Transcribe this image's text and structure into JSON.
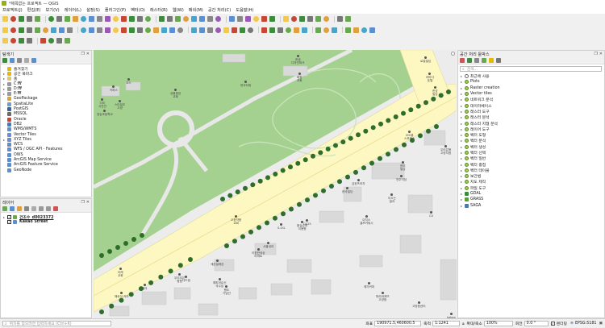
{
  "window": {
    "title": "*제목없는 프로젝트 — QGIS"
  },
  "menu": [
    "프로젝트(J)",
    "편집(E)",
    "보기(V)",
    "레이어(L)",
    "설정(S)",
    "플러그인(P)",
    "벡터(O)",
    "래스터(R)",
    "웹(W)",
    "메쉬(M)",
    "공간 처리(C)",
    "도움말(H)"
  ],
  "browser_panel": {
    "title": "탐색기",
    "items": [
      {
        "label": "즐겨찾기",
        "icon": "star-icon",
        "color": "#e6b800",
        "expand": ""
      },
      {
        "label": "공간 북마크",
        "icon": "bookmark-icon",
        "color": "#e6b800",
        "expand": "▸"
      },
      {
        "label": "홈",
        "icon": "home-folder-icon",
        "color": "#e9c36a",
        "expand": "▸"
      },
      {
        "label": "C:₩",
        "icon": "drive-icon",
        "color": "#999999",
        "expand": "▸"
      },
      {
        "label": "D:₩",
        "icon": "drive-icon",
        "color": "#999999",
        "expand": "▸"
      },
      {
        "label": "E:₩",
        "icon": "drive-icon",
        "color": "#999999",
        "expand": "▸"
      },
      {
        "label": "GeoPackage",
        "icon": "geopackage-icon",
        "color": "#d4a640",
        "expand": ""
      },
      {
        "label": "SpatiaLite",
        "icon": "spatialite-icon",
        "color": "#6f9dd6",
        "expand": ""
      },
      {
        "label": "PostGIS",
        "icon": "postgis-icon",
        "color": "#3466a5",
        "expand": ""
      },
      {
        "label": "MSSQL",
        "icon": "mssql-icon",
        "color": "#6a6a6a",
        "expand": ""
      },
      {
        "label": "Oracle",
        "icon": "oracle-icon",
        "color": "#c74634",
        "expand": ""
      },
      {
        "label": "DB2",
        "icon": "db2-icon",
        "color": "#4a7ab3",
        "expand": ""
      },
      {
        "label": "WMS/WMTS",
        "icon": "wms-icon",
        "color": "#5b8fd0",
        "expand": ""
      },
      {
        "label": "Vector Tiles",
        "icon": "vector-tiles-icon",
        "color": "#6f8cd0",
        "expand": ""
      },
      {
        "label": "XYZ Tiles",
        "icon": "xyz-tiles-icon",
        "color": "#6f8cd0",
        "expand": "▸"
      },
      {
        "label": "WCS",
        "icon": "wcs-icon",
        "color": "#5b8fd0",
        "expand": ""
      },
      {
        "label": "WFS / OGC API - Features",
        "icon": "wfs-icon",
        "color": "#5b8fd0",
        "expand": ""
      },
      {
        "label": "OWS",
        "icon": "ows-icon",
        "color": "#5b8fd0",
        "expand": ""
      },
      {
        "label": "ArcGIS Map Service",
        "icon": "arcgis-icon",
        "color": "#5b8fd0",
        "expand": ""
      },
      {
        "label": "ArcGIS Feature Service",
        "icon": "arcgis-icon",
        "color": "#5b8fd0",
        "expand": ""
      },
      {
        "label": "GeoNode",
        "icon": "geonode-icon",
        "color": "#5b8fd0",
        "expand": ""
      }
    ]
  },
  "layers_panel": {
    "title": "레이어",
    "layers": [
      {
        "label": "건조수_d0023372",
        "underline": true
      },
      {
        "label": "Kakao Street",
        "underline": false
      }
    ]
  },
  "toolbox_panel": {
    "title": "공간 처리 툴박스",
    "search_placeholder": "검색...",
    "items": [
      {
        "label": "최근에 사용",
        "icon": "clock-icon"
      },
      {
        "label": "Plots",
        "icon": "algorithm-icon"
      },
      {
        "label": "Raster creation",
        "icon": "algorithm-icon"
      },
      {
        "label": "Vector tiles",
        "icon": "algorithm-icon"
      },
      {
        "label": "네트워크 분석",
        "icon": "algorithm-icon"
      },
      {
        "label": "데이터베이스",
        "icon": "algorithm-icon"
      },
      {
        "label": "래스터 도구",
        "icon": "algorithm-icon"
      },
      {
        "label": "래스터 분석",
        "icon": "algorithm-icon"
      },
      {
        "label": "래스터 지형 분석",
        "icon": "algorithm-icon"
      },
      {
        "label": "레이어 도구",
        "icon": "algorithm-icon"
      },
      {
        "label": "벡터 도형",
        "icon": "algorithm-icon"
      },
      {
        "label": "벡터 분석",
        "icon": "algorithm-icon"
      },
      {
        "label": "벡터 생성",
        "icon": "algorithm-icon"
      },
      {
        "label": "벡터 선택",
        "icon": "algorithm-icon"
      },
      {
        "label": "벡터 일반",
        "icon": "algorithm-icon"
      },
      {
        "label": "벡터 중첩",
        "icon": "algorithm-icon"
      },
      {
        "label": "벡터 테이블",
        "icon": "algorithm-icon"
      },
      {
        "label": "보간법",
        "icon": "algorithm-icon"
      },
      {
        "label": "지도 제작",
        "icon": "algorithm-icon"
      },
      {
        "label": "파일 도구",
        "icon": "algorithm-icon"
      },
      {
        "label": "GDAL",
        "icon": "gdal-icon"
      },
      {
        "label": "GRASS",
        "icon": "grass-icon"
      },
      {
        "label": "SAGA",
        "icon": "saga-icon"
      }
    ]
  },
  "map_labels": [
    {
      "text": "한샘\n디자인파크"
    },
    {
      "text": "코스"
    },
    {
      "text": "키퍼스"
    },
    {
      "text": "상봉중앙\n교회"
    },
    {
      "text": "스타일조\n고양"
    },
    {
      "text": "다이\n사진관"
    },
    {
      "text": "한국타워"
    },
    {
      "text": "영송초등학교"
    },
    {
      "text": "화정\n교회"
    },
    {
      "text": "로열빌딩"
    },
    {
      "text": "라마다\n호텔"
    },
    {
      "text": "한성\n빌딩"
    },
    {
      "text": "우리은행\n고양지점"
    },
    {
      "text": "코오롱\n스포렉스"
    },
    {
      "text": "금호프라자"
    },
    {
      "text": "한국빌딩"
    },
    {
      "text": "이끄는\n빌라"
    },
    {
      "text": "이지스\n셀프카워시"
    },
    {
      "text": "CU"
    },
    {
      "text": "한미\n빌딩"
    },
    {
      "text": "전주식당"
    },
    {
      "text": "오정약품\n교회"
    },
    {
      "text": "S-OIL"
    },
    {
      "text": "GS25"
    },
    {
      "text": "황실슈퍼\n이용원"
    },
    {
      "text": "서울내과"
    },
    {
      "text": "이편한세상\n아파트"
    },
    {
      "text": "세븐일레븐"
    },
    {
      "text": "이레\n교회"
    },
    {
      "text": "우리조은\n병원"
    },
    {
      "text": "메가커피"
    },
    {
      "text": "파리바게뜨\n고양점"
    },
    {
      "text": "고양동센터"
    },
    {
      "text": "행도\n기념관"
    },
    {
      "text": "해로이 카라"
    },
    {
      "text": "나드림"
    },
    {
      "text": "해피어르신\n국수집"
    },
    {
      "text": "태극"
    },
    {
      "text": "kakao"
    }
  ],
  "status": {
    "search_placeholder": "위치를 찾으려면 입력하세요 (Ctrl+K)",
    "coord_label": "좌표",
    "coord_value": "190971.5,460600.5",
    "scale_label": "축척",
    "scale_value": "1:1241",
    "magnifier_label": "확대/축소",
    "magnifier_value": "100%",
    "rotation_label": "회전",
    "rotation_value": "0.0 °",
    "render_label": "렌더링",
    "crs": "EPSG:5181"
  },
  "colors": {
    "park": "#a4d18f",
    "road": "#fdf8c2",
    "ground": "#ececec",
    "tree": "#2f6e2a",
    "accent": "#93b023"
  }
}
